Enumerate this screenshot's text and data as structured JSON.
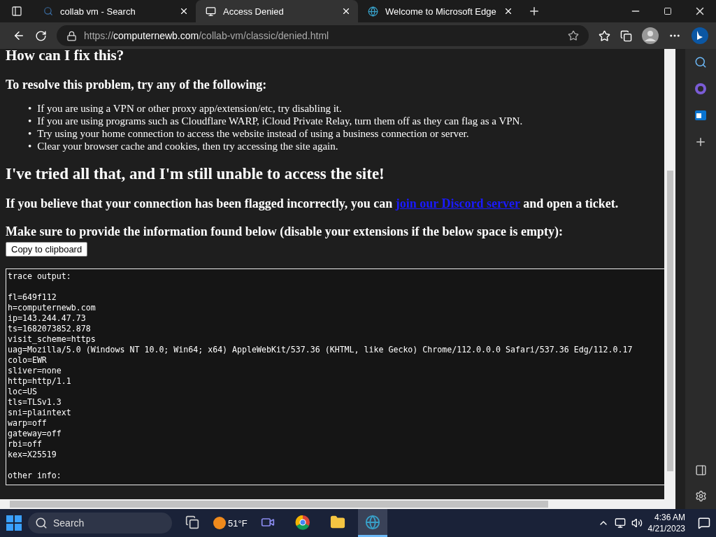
{
  "tabs": [
    {
      "title": "collab vm - Search",
      "selected": false,
      "kind": "search"
    },
    {
      "title": "Access Denied",
      "selected": true,
      "kind": "site"
    },
    {
      "title": "Welcome to Microsoft Edge",
      "selected": false,
      "kind": "edge"
    }
  ],
  "address": {
    "scheme": "https://",
    "domain": "computernewb.com",
    "path": "/collab-vm/classic/denied.html"
  },
  "page": {
    "heading": "How can I fix this?",
    "subheading": "To resolve this problem, try any of the following:",
    "tip_marker": "•",
    "tips": [
      "If you are using a VPN or other proxy app/extension/etc, try disabling it.",
      "If you are using programs such as Cloudflare WARP, iCloud Private Relay, turn them off as they can flag as a VPN.",
      "Try using your home connection to access the website instead of using a business connection or server.",
      "Clear your browser cache and cookies, then try accessing the site again."
    ],
    "heading_2": "I've tried all that, and I'm still unable to access the site!",
    "ticket": {
      "before": "If you believe that your connection has been flagged incorrectly, you can ",
      "link": "join our Discord server",
      "after": " and open a ticket."
    },
    "instructions": "Make sure to provide the information found below (disable your extensions if the below space is empty):",
    "copy_button": "Copy to clipboard",
    "trace_header": "trace output:",
    "trace_lines": [
      "fl=649f112",
      "h=computernewb.com",
      "ip=143.244.47.73",
      "ts=1682073852.878",
      "visit_scheme=https",
      "uag=Mozilla/5.0 (Windows NT 10.0; Win64; x64) AppleWebKit/537.36 (KHTML, like Gecko) Chrome/112.0.0.0 Safari/537.36 Edg/112.0.17",
      "colo=EWR",
      "sliver=none",
      "http=http/1.1",
      "loc=US",
      "tls=TLSv1.3",
      "sni=plaintext",
      "warp=off",
      "gateway=off",
      "rbi=off",
      "kex=X25519"
    ],
    "other_header": "other info:"
  },
  "taskbar": {
    "search": "Search",
    "weather": "51°F",
    "apps": [
      {
        "kind": "taskview",
        "selected": false
      },
      {
        "kind": "teams",
        "selected": false
      },
      {
        "kind": "chrome",
        "selected": false
      },
      {
        "kind": "files",
        "selected": false
      },
      {
        "kind": "edge",
        "selected": true
      }
    ],
    "time": "4:36 AM",
    "date": "4/21/2023"
  }
}
